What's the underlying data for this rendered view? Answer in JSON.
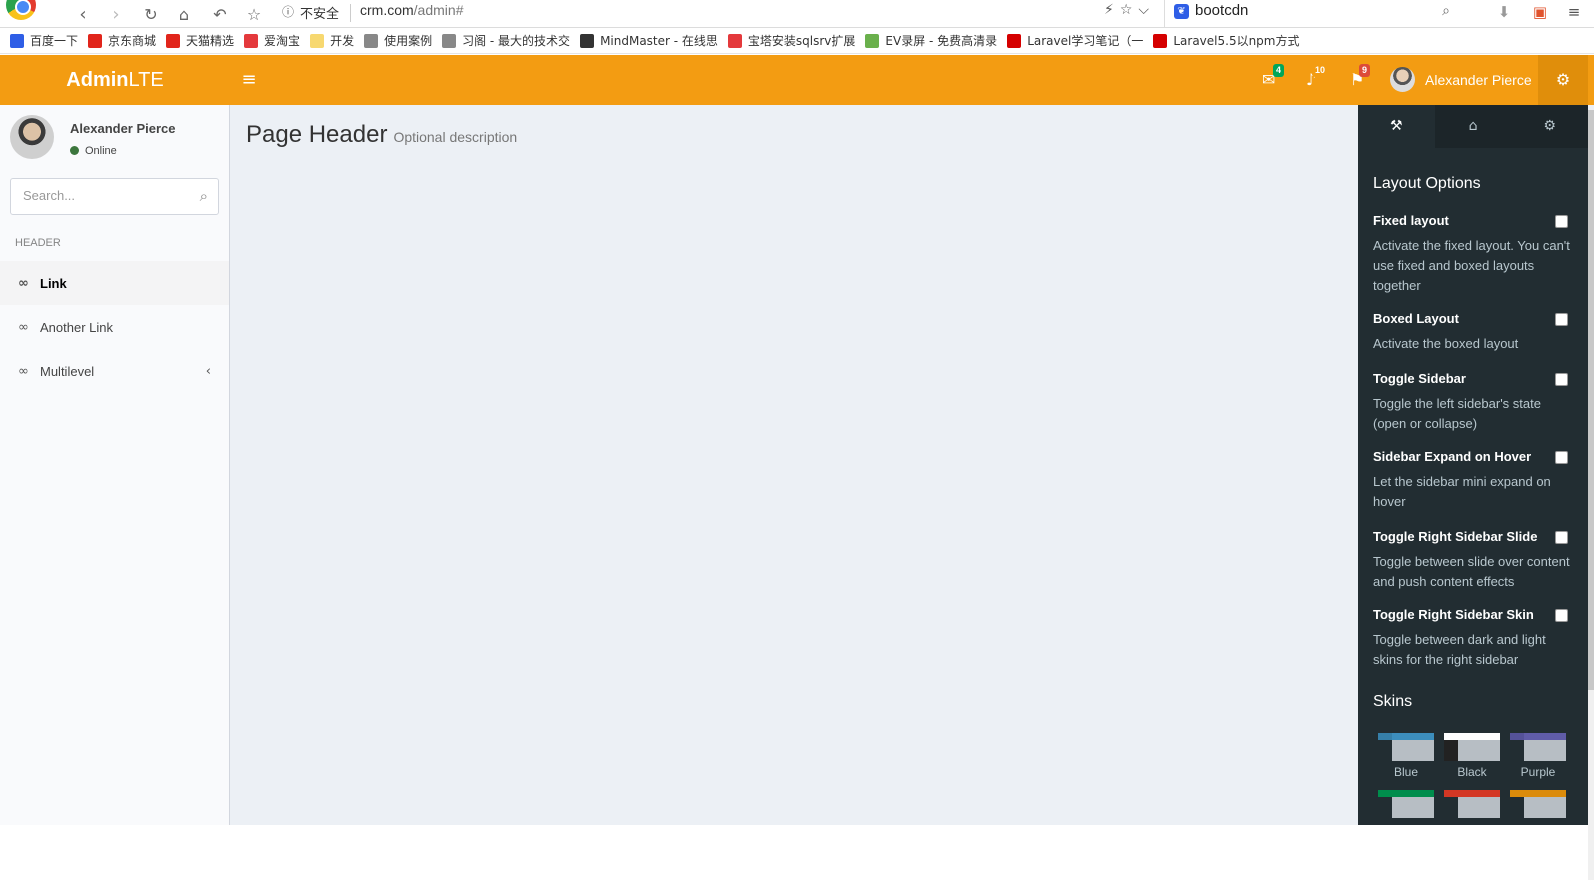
{
  "browser": {
    "insecure_label": "不安全",
    "url_host": "crm.com",
    "url_path": "/admin#",
    "search_query": "bootcdn"
  },
  "bookmarks": [
    {
      "label": "百度一下",
      "color": "#2f5ee6",
      "icon": "baidu-icon"
    },
    {
      "label": "京东商城",
      "color": "#e1251b",
      "icon": "jd-icon"
    },
    {
      "label": "天猫精选",
      "color": "#e1251b",
      "icon": "tmall-icon"
    },
    {
      "label": "爱淘宝",
      "color": "#e4393c",
      "icon": "taobao-icon"
    },
    {
      "label": "开发",
      "color": "#f7d870",
      "icon": "folder-icon"
    },
    {
      "label": "使用案例",
      "color": "#888888",
      "icon": "page-icon"
    },
    {
      "label": "习阁 - 最大的技术交",
      "color": "#888888",
      "icon": "page-icon"
    },
    {
      "label": "MindMaster - 在线思",
      "color": "#333333",
      "icon": "mindmaster-icon"
    },
    {
      "label": "宝塔安装sqlsrv扩展",
      "color": "#e4393c",
      "icon": "jianshu-icon"
    },
    {
      "label": "EV录屏 - 免费高清录",
      "color": "#6ab04c",
      "icon": "ev-icon"
    },
    {
      "label": "Laravel学习笔记（一",
      "color": "#d50000",
      "icon": "csdn-icon"
    },
    {
      "label": "Laravel5.5以npm方式",
      "color": "#d50000",
      "icon": "csdn-icon"
    }
  ],
  "header": {
    "logo_bold": "Admin",
    "logo_light": "LTE",
    "messages_count": "4",
    "notifications_count": "10",
    "tasks_count": "9",
    "user_name": "Alexander Pierce"
  },
  "sidebar": {
    "user_name": "Alexander Pierce",
    "status": "Online",
    "search_placeholder": "Search...",
    "section_header": "HEADER",
    "items": [
      {
        "label": "Link"
      },
      {
        "label": "Another Link"
      },
      {
        "label": "Multilevel"
      }
    ]
  },
  "content": {
    "title": "Page Header",
    "description": "Optional description"
  },
  "control_sidebar": {
    "layout_title": "Layout Options",
    "options": [
      {
        "label": "Fixed layout",
        "desc": "Activate the fixed layout. You can't use fixed and boxed layouts together"
      },
      {
        "label": "Boxed Layout",
        "desc": "Activate the boxed layout"
      },
      {
        "label": "Toggle Sidebar",
        "desc": "Toggle the left sidebar's state (open or collapse)"
      },
      {
        "label": "Sidebar Expand on Hover",
        "desc": "Let the sidebar mini expand on hover"
      },
      {
        "label": "Toggle Right Sidebar Slide",
        "desc": "Toggle between slide over content and push content effects"
      },
      {
        "label": "Toggle Right Sidebar Skin",
        "desc": "Toggle between dark and light skins for the right sidebar"
      }
    ],
    "skins_title": "Skins",
    "skins": [
      {
        "name": "Blue",
        "color": "#367fa9",
        "accent": "#3c8dbc"
      },
      {
        "name": "Black",
        "color": "#fefefe",
        "accent": "#fefefe"
      },
      {
        "name": "Purple",
        "color": "#555299",
        "accent": "#605ca8"
      }
    ],
    "skins_row2_colors": [
      "#008d4c",
      "#d33724",
      "#db8b0b"
    ]
  },
  "colors": {
    "header": "#f39c12",
    "sidebar": "#f9fafc",
    "control_sidebar": "#222d32",
    "content_bg": "#ecf0f5"
  }
}
